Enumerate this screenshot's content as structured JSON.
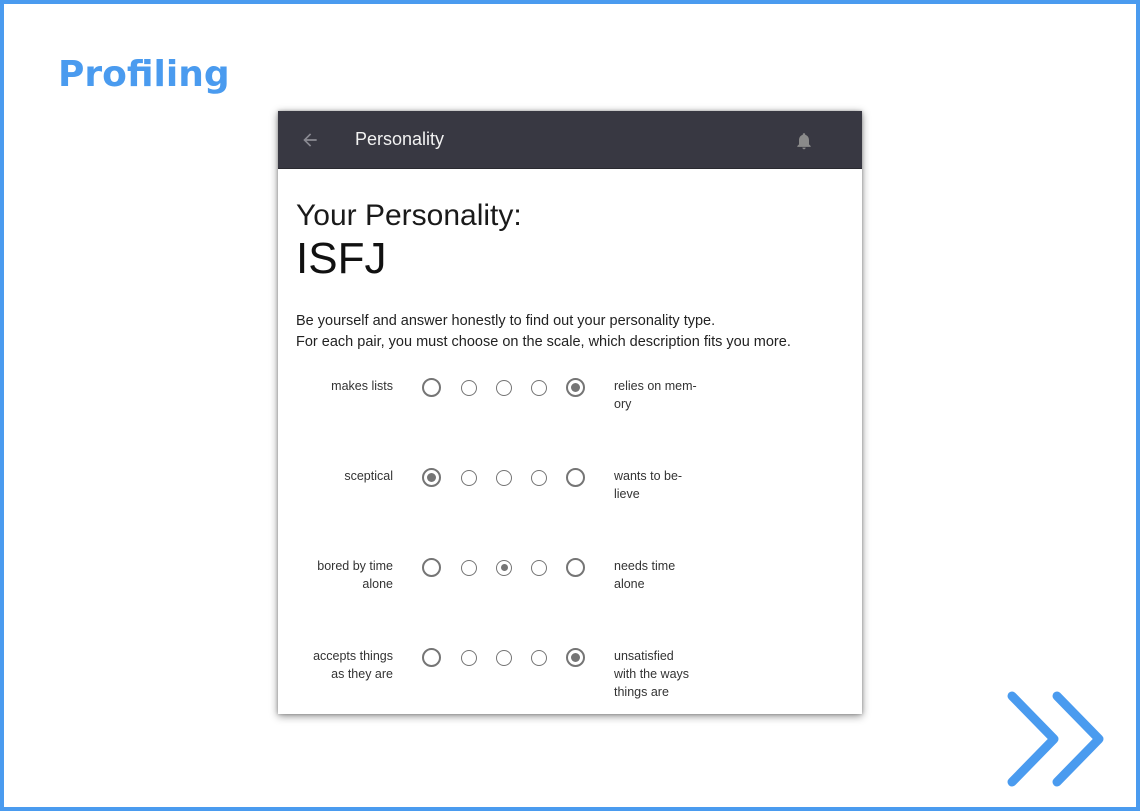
{
  "slide": {
    "title": "Profiling",
    "accent_color": "#4a9bef",
    "next_icon": "double-chevron-right-icon"
  },
  "appbar": {
    "title": "Personality",
    "back_icon": "arrow-left-icon",
    "notification_icon": "bell-icon",
    "background": "#383842"
  },
  "page": {
    "heading": "Your Personality:",
    "result": "ISFJ",
    "intro_line1": "Be yourself and answer honestly to find out your personality type.",
    "intro_line2": "For each pair, you must choose on the scale, which description fits you more."
  },
  "questions": [
    {
      "left": "makes lists",
      "right": "relies on mem-\nory",
      "scale_points": 5,
      "selected": 5
    },
    {
      "left": "sceptical",
      "right": "wants to be-\nlieve",
      "scale_points": 5,
      "selected": 1
    },
    {
      "left": "bored by time\nalone",
      "right": "needs time\nalone",
      "scale_points": 5,
      "selected": 3
    },
    {
      "left": "accepts things\nas they are",
      "right": "unsatisfied\nwith the ways\nthings are",
      "scale_points": 5,
      "selected": 5
    }
  ]
}
